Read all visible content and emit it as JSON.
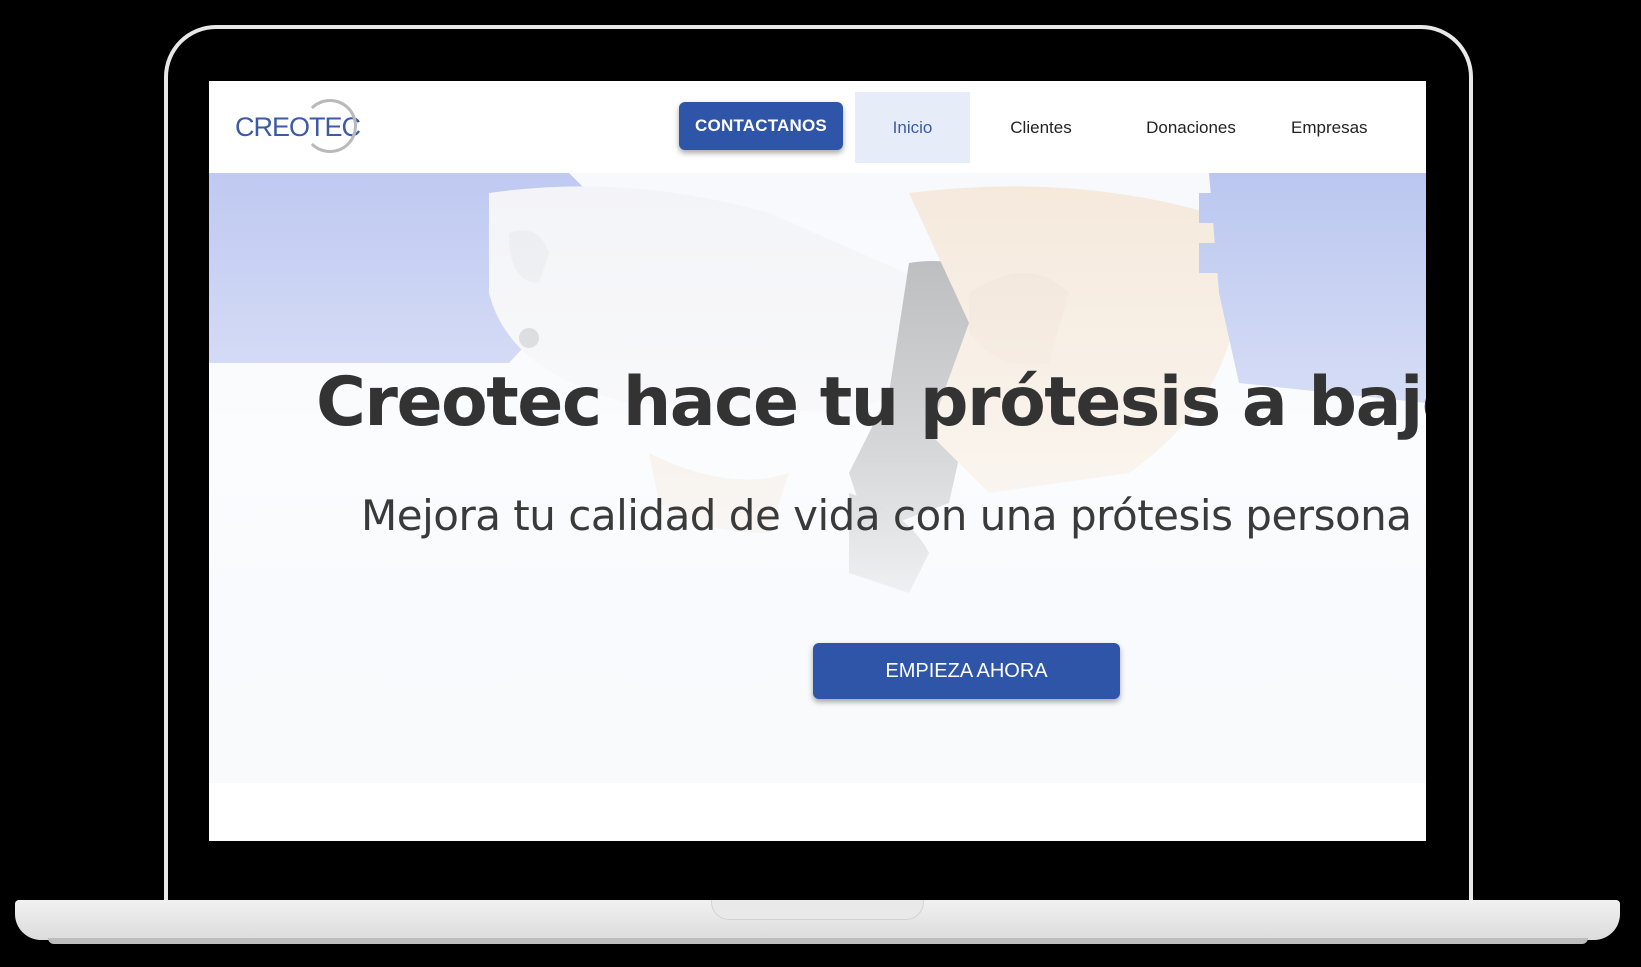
{
  "site": {
    "logo_text": "CREOTEC"
  },
  "nav": {
    "contact_label": "CONTACTANOS",
    "items": [
      {
        "label": "Inicio",
        "active": true
      },
      {
        "label": "Clientes",
        "active": false
      },
      {
        "label": "Donaciones",
        "active": false
      },
      {
        "label": "Empresas",
        "active": false
      }
    ]
  },
  "hero": {
    "title": "Creotec hace tu prótesis a bajo c",
    "subtitle": "Mejora tu calidad de vida con una prótesis persona",
    "cta_label": "EMPIEZA AHORA",
    "background_image": "robot-hand-handshake-photo"
  },
  "colors": {
    "brand_blue": "#2f55a8",
    "logo_blue": "#3b5ba5",
    "active_nav_bg": "#e7edf8",
    "heading_text": "#333333"
  }
}
